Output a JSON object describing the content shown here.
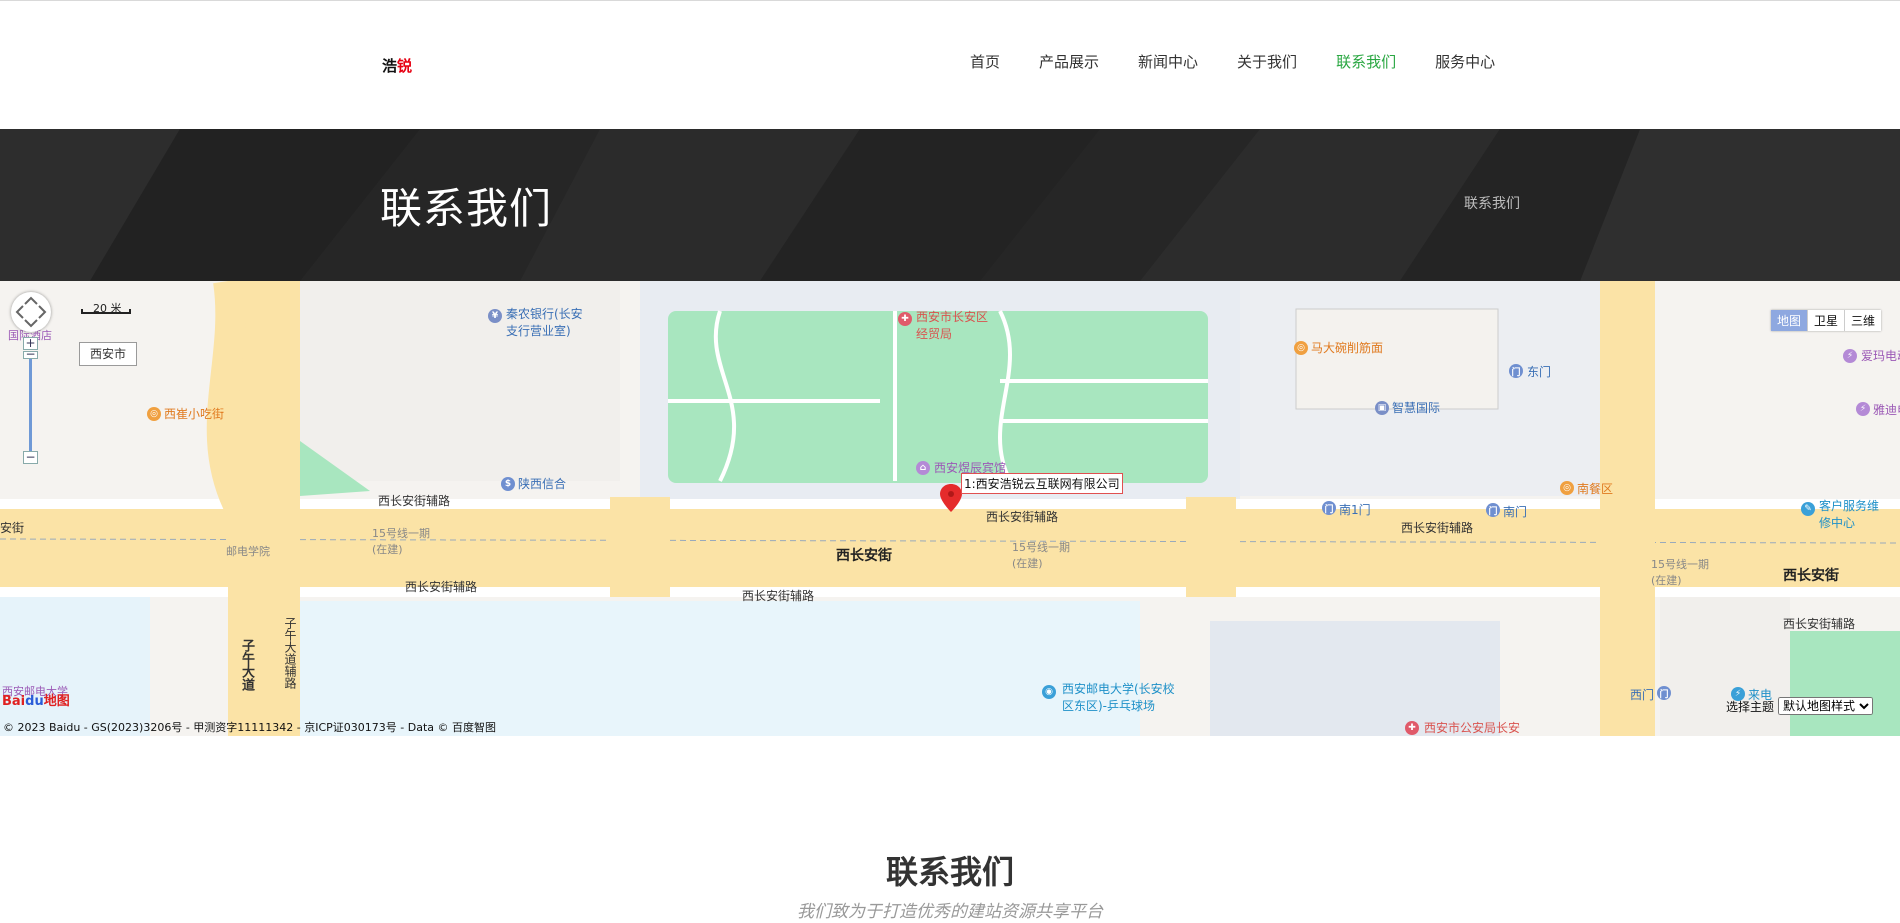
{
  "logo": {
    "part1": "浩",
    "part2": "锐"
  },
  "nav": {
    "items": [
      {
        "label": "首页",
        "active": false
      },
      {
        "label": "产品展示",
        "active": false
      },
      {
        "label": "新闻中心",
        "active": false
      },
      {
        "label": "关于我们",
        "active": false
      },
      {
        "label": "联系我们",
        "active": true
      },
      {
        "label": "服务中心",
        "active": false
      }
    ],
    "active_color": "#2aa742"
  },
  "banner": {
    "title": "联系我们",
    "breadcrumb": "联系我们"
  },
  "map": {
    "scale_label": "20 米",
    "city_button": "西安市",
    "marker_label": "1:西安浩锐云互联网有限公司",
    "map_types": [
      "地图",
      "卫星",
      "三维"
    ],
    "theme_label": "选择主题",
    "theme_selected": "默认地图样式",
    "copyright": "© 2023 Baidu - GS(2023)3206号 - 甲测资字11111342 - 京ICP证030173号 - Data © 百度智图",
    "baidu_logo": {
      "part1": "Bai",
      "part2": "du",
      "part3": "地图"
    },
    "labels": {
      "road_main_1": "西长安街",
      "road_main_2": "西长安街",
      "road_main_3": "西长安街",
      "aux_1": "西长安街辅路",
      "aux_2": "西长安街辅路",
      "aux_3": "西长安街辅路",
      "aux_4": "西长安街辅路",
      "aux_5": "西长安街辅路",
      "aux_6": "西长安街辅路",
      "aux_7": "西长安街辅路",
      "ziwu": "子午大道",
      "ziwu_aux": "子午大道辅路",
      "metro_1": "15号线一期(在建)",
      "metro_2": "15号线一期(在建)",
      "metro_3": "15号线一期(在建)",
      "youdian": "邮电学院",
      "qinnong": "秦农银行(长安支行营业室)",
      "trade_bureau": "西安市长安区经贸局",
      "hotel": "西安煜辰宾馆",
      "shaanxi_trust": "陕西信合",
      "xicui": "西崔小吃街",
      "madawan": "马大碗削筋面",
      "zhihui": "智慧国际",
      "east_gate": "东门",
      "south_gate_1": "南1门",
      "south_gate_2": "南门",
      "south_dining": "南餐区",
      "west_gate": "西门",
      "customer_service": "客户服务维修中心",
      "aima": "爱玛电动",
      "yadi": "雅迪电",
      "youdian_univ": "西安邮电大学(长安校区东区)-乒乓球场",
      "police": "西安市公安局长安",
      "xiyou_univ_left": "西安邮电大学",
      "intl_hotel": "国际酒店",
      "laidian": "来电",
      "left_street": "安街"
    }
  },
  "contact": {
    "title": "联系我们",
    "subtitle": "我们致为于打造优秀的建站资源共享平台"
  }
}
